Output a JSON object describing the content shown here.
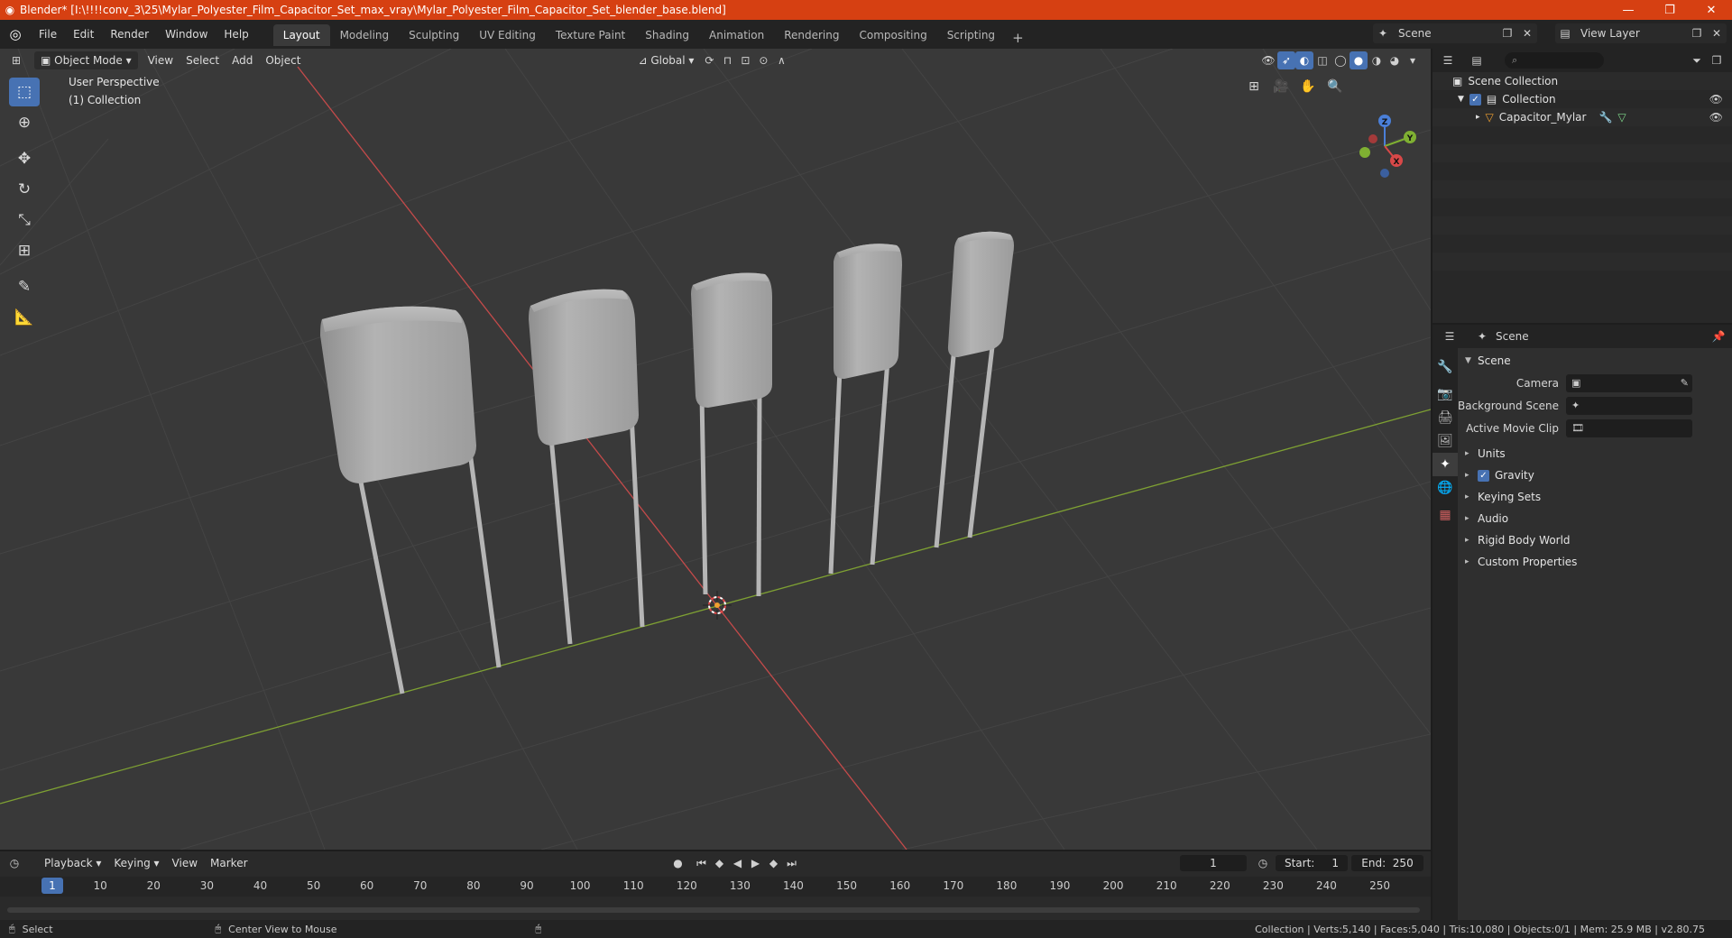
{
  "window": {
    "title": "Blender* [I:\\!!!!conv_3\\25\\Mylar_Polyester_Film_Capacitor_Set_max_vray\\Mylar_Polyester_Film_Capacitor_Set_blender_base.blend]",
    "minimize": "—",
    "restore": "❐",
    "close": "✕"
  },
  "menu": {
    "items": [
      "File",
      "Edit",
      "Render",
      "Window",
      "Help"
    ]
  },
  "workspaces": {
    "tabs": [
      "Layout",
      "Modeling",
      "Sculpting",
      "UV Editing",
      "Texture Paint",
      "Shading",
      "Animation",
      "Rendering",
      "Compositing",
      "Scripting"
    ],
    "active": "Layout",
    "add": "+"
  },
  "scene_selector": {
    "value": "Scene"
  },
  "viewlayer_selector": {
    "value": "View Layer"
  },
  "viewport": {
    "mode": "Object Mode",
    "menus": [
      "View",
      "Select",
      "Add",
      "Object"
    ],
    "orientation": "Global",
    "perspective_label": "User Perspective",
    "collection_label": "(1) Collection",
    "colors": {
      "background": "#393939",
      "grid": "#444444",
      "x_axis": "#c44a4a",
      "y_axis": "#7ea033",
      "capacitor": "#a9a9a9"
    },
    "gizmo": {
      "x": "X",
      "y": "Y",
      "z": "Z"
    }
  },
  "outliner": {
    "search_placeholder": "⌕",
    "rows": [
      {
        "label": "Scene Collection"
      },
      {
        "label": "Collection"
      },
      {
        "label": "Capacitor_Mylar"
      }
    ]
  },
  "properties": {
    "header": "Scene",
    "section": "Scene",
    "fields": [
      {
        "label": "Camera",
        "value": ""
      },
      {
        "label": "Background Scene",
        "value": ""
      },
      {
        "label": "Active Movie Clip",
        "value": ""
      }
    ],
    "panels": [
      "Units",
      "Gravity",
      "Keying Sets",
      "Audio",
      "Rigid Body World",
      "Custom Properties"
    ]
  },
  "timeline": {
    "menus": [
      "Playback",
      "Keying",
      "View",
      "Marker"
    ],
    "current_frame": "1",
    "start_label": "Start:",
    "start": "1",
    "end_label": "End:",
    "end": "250",
    "ticks": [
      "10",
      "20",
      "30",
      "40",
      "50",
      "60",
      "70",
      "80",
      "90",
      "100",
      "110",
      "120",
      "130",
      "140",
      "150",
      "160",
      "170",
      "180",
      "190",
      "200",
      "210",
      "220",
      "230",
      "240",
      "250"
    ]
  },
  "statusbar": {
    "select": "Select",
    "center": "Center View to Mouse",
    "stats": "Collection | Verts:5,140 | Faces:5,040 | Tris:10,080 | Objects:0/1 | Mem: 25.9 MB | v2.80.75"
  }
}
